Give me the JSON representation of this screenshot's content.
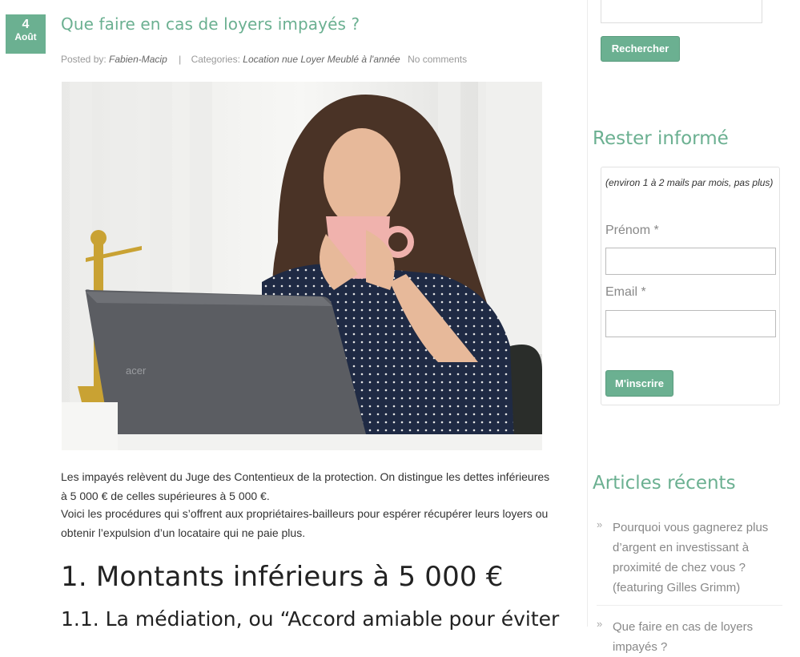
{
  "post": {
    "date_day": "4",
    "date_month": "Août",
    "title": "Que faire en cas de loyers impayés ?",
    "posted_by_label": "Posted by:",
    "author": "Fabien-Macip",
    "categories_label": "Categories:",
    "categories": "Location nue Loyer Meublé à l'année",
    "comments": "No comments",
    "image_alt": "Femme buvant dans une tasse rose devant un ordinateur portable",
    "paragraph1": "Les impayés relèvent du Juge des Contentieux de la protection. On distingue les dettes inférieures à 5 000 € de celles supérieures à 5 000 €.",
    "paragraph2": "Voici les procédures qui s’offrent aux propriétaires-bailleurs pour espérer récupérer leurs loyers ou obtenir l’expulsion d’un locataire qui ne paie plus.",
    "heading2": "1. Montants inférieurs à 5 000 €",
    "heading3": "1.1. La médiation, ou “Accord amiable pour éviter"
  },
  "sidebar": {
    "search_button": "Rechercher",
    "newsletter_title": "Rester informé",
    "newsletter_note": "(environ 1 à 2 mails par mois, pas plus)",
    "firstname_label": "Prénom *",
    "email_label": "Email *",
    "subscribe_button": "M'inscrire",
    "recent_title": "Articles récents",
    "recent_articles": [
      "Pourquoi vous gagnerez plus d’argent en investissant à proximité de chez vous ? (featuring Gilles Grimm)",
      "Que faire en cas de loyers impayés ?"
    ]
  },
  "colors": {
    "accent": "#6bb091",
    "text": "#333333",
    "muted": "#999999"
  }
}
